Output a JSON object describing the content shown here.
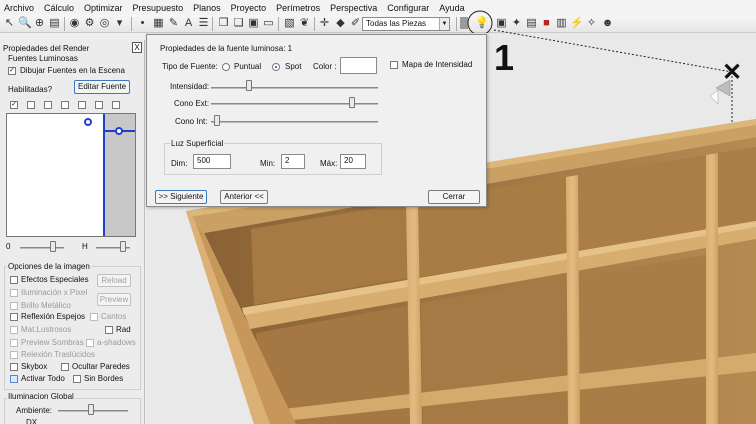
{
  "menu": [
    "Archivo",
    "Cálculo",
    "Optimizar",
    "Presupuesto",
    "Planos",
    "Proyecto",
    "Perímetros",
    "Perspectiva",
    "Configurar",
    "Ayuda"
  ],
  "toolbar": {
    "pieces_filter": "Todas las Piezas"
  },
  "left_panel": {
    "title": "Propiedades del Render",
    "close": "X",
    "light_sources_label": "Fuentes Luminosas",
    "draw_sources_label": "Dibujar Fuentes en la Escena",
    "enabled_label": "Habilitadas?",
    "edit_source_button": "Editar Fuente",
    "slider_o_label": "0",
    "slider_h_label": "H",
    "image_options_title": "Opciones de la imagen",
    "special_effects": "Efectos Especiales",
    "reload_button": "Reload",
    "pixel_lighting": "Iluminación x Pixel",
    "preview_button": "Preview",
    "metallic_shine": "Brillo Metálico",
    "mirror_reflection": "Reflexión Espejos",
    "edges": "Cantos",
    "glossy_mat": "Mat.Lustrosos",
    "rad": "Rad",
    "preview_shadows": "Preview Sombras",
    "a_shadows": "a-shadows",
    "translucent_reflection": "Relexión Traslúcidos",
    "skybox": "Skybox",
    "hide_walls": "Ocultar Paredes",
    "activate_all": "Activar Todo",
    "no_borders": "Sin Bordes",
    "global_lighting_title": "Iluminacion Global",
    "ambient_label": "Ambiente:",
    "dx_label": "DX"
  },
  "dialog": {
    "title": "Propiedades de la fuente luminosa: 1",
    "source_type_label": "Tipo de Fuente:",
    "punctual_label": "Puntual",
    "spot_label": "Spot",
    "color_label": "Color :",
    "intensity_map_label": "Mapa de Intensidad",
    "intensity_label": "Intensidad:",
    "cone_ext_label": "Cono Ext:",
    "cone_int_label": "Cono Int:",
    "surface_light_title": "Luz Superficial",
    "dim_label": "Dim:",
    "dim_value": "500",
    "min_label": "Min:",
    "min_value": "2",
    "max_label": "Máx:",
    "max_value": "20",
    "next_button": ">> Siguiente",
    "prev_button": "Anterior <<",
    "close_button": "Cerrar",
    "intensity_level": 0.22,
    "cone_ext_level": 0.86,
    "cone_int_level": 0.02
  },
  "scene": {
    "light_number": "1"
  },
  "colors": {
    "wood": "#c99a5c",
    "wood_dark": "#8e6535",
    "accent_blue": "#1f3fd0"
  }
}
